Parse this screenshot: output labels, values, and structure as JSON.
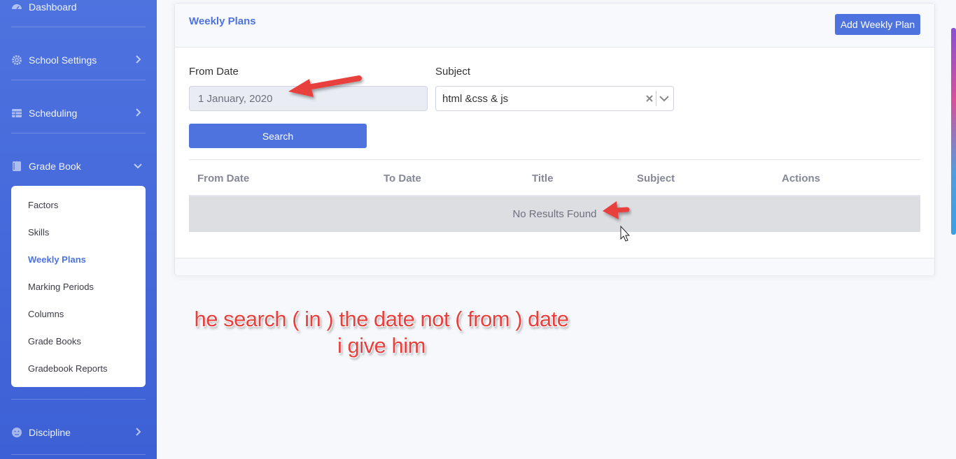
{
  "sidebar": {
    "items": [
      {
        "label": "Dashboard",
        "icon": "dashboard-icon"
      },
      {
        "label": "School Settings",
        "icon": "gear-icon"
      },
      {
        "label": "Scheduling",
        "icon": "table-icon"
      },
      {
        "label": "Grade Book",
        "icon": "book-icon"
      },
      {
        "label": "Discipline",
        "icon": "face-icon"
      }
    ],
    "submenu": [
      "Factors",
      "Skills",
      "Weekly Plans",
      "Marking Periods",
      "Columns",
      "Grade Books",
      "Gradebook Reports"
    ],
    "active_submenu": "Weekly Plans"
  },
  "card": {
    "title": "Weekly Plans",
    "add_button": "Add Weekly Plan"
  },
  "filters": {
    "from_date_label": "From Date",
    "from_date_value": "1 January, 2020",
    "subject_label": "Subject",
    "subject_value": "html &css & js",
    "search_button": "Search"
  },
  "table": {
    "columns": [
      "From Date",
      "To Date",
      "Title",
      "Subject",
      "Actions"
    ],
    "empty_text": "No Results Found"
  },
  "annotation": {
    "line1": "he search ( in ) the date not ( from ) date",
    "line2": "i give him",
    "color": "#e8403e"
  },
  "colors": {
    "primary": "#4e73df",
    "sidebar_bg": "#4e73df"
  }
}
